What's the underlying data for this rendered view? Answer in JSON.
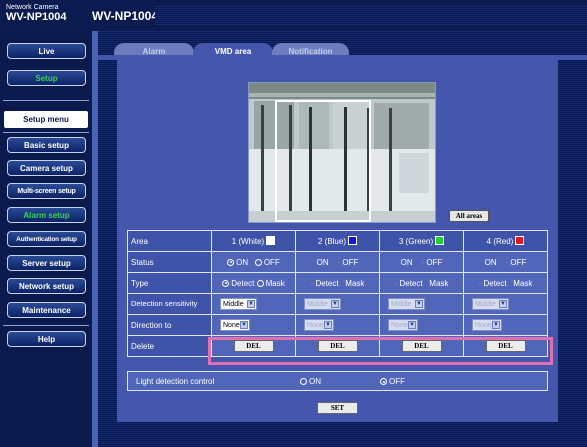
{
  "header": {
    "model_small": "Network Camera",
    "model": "WV-NP1004",
    "title": "WV-NP1004"
  },
  "sidebar": {
    "live": "Live",
    "setup": "Setup",
    "setup_menu": "Setup menu",
    "items": [
      {
        "label": "Basic setup"
      },
      {
        "label": "Camera setup"
      },
      {
        "label": "Multi-screen setup"
      },
      {
        "label": "Alarm setup"
      },
      {
        "label": "Authentication setup"
      },
      {
        "label": "Server setup"
      },
      {
        "label": "Network setup"
      },
      {
        "label": "Maintenance"
      }
    ],
    "help": "Help"
  },
  "tabs": [
    {
      "label": "Alarm"
    },
    {
      "label": "VMD area"
    },
    {
      "label": "Notification"
    }
  ],
  "preview": {
    "all_areas": "All areas"
  },
  "grid": {
    "row_labels": {
      "area": "Area",
      "status": "Status",
      "type": "Type",
      "sensitivity": "Detection sensitivity",
      "direction": "Direction to",
      "delete": "Delete"
    },
    "areas": [
      {
        "label": "1 (White)",
        "color": "#ffffff"
      },
      {
        "label": "2 (Blue)",
        "color": "#1515e6"
      },
      {
        "label": "3 (Green)",
        "color": "#22d22a"
      },
      {
        "label": "4 (Red)",
        "color": "#e01a1a"
      }
    ],
    "on": "ON",
    "off": "OFF",
    "detect": "Detect",
    "mask": "Mask",
    "sensitivity_value": "Middle",
    "direction_value": "None",
    "del": "DEL"
  },
  "light": {
    "label": "Light detection control",
    "on": "ON",
    "off": "OFF"
  },
  "set_button": "SET",
  "colors": {
    "background": "#0d1e55",
    "panel": "#4557ad",
    "highlight": "#e070b0",
    "active_menu_text": "#39d35a"
  }
}
